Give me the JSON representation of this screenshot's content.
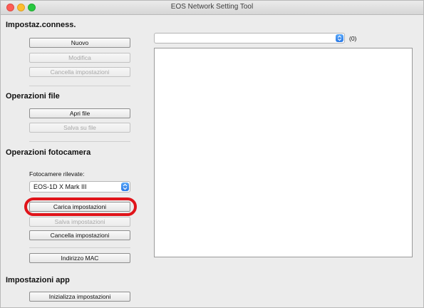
{
  "window": {
    "title": "EOS Network Setting Tool"
  },
  "connection": {
    "title": "Impostaz.conness.",
    "new_label": "Nuovo",
    "edit_label": "Modifica",
    "delete_label": "Cancella impostazioni"
  },
  "file_ops": {
    "title": "Operazioni file",
    "open_label": "Apri file",
    "save_label": "Salva su file"
  },
  "camera_ops": {
    "title": "Operazioni fotocamera",
    "detected_label": "Fotocamere rilevate:",
    "selected_camera": "EOS-1D X Mark III",
    "load_label": "Carica impostazioni",
    "save_label": "Salva impostazioni",
    "delete_label": "Cancella impostazioni",
    "mac_label": "Indirizzo MAC"
  },
  "app_settings": {
    "title": "Impostazioni app",
    "init_label": "Inizializza impostazioni"
  },
  "main": {
    "dropdown_value": "",
    "count_label": "(0)"
  },
  "colors": {
    "highlight": "#e0141a",
    "accent": "#2a79e6"
  }
}
